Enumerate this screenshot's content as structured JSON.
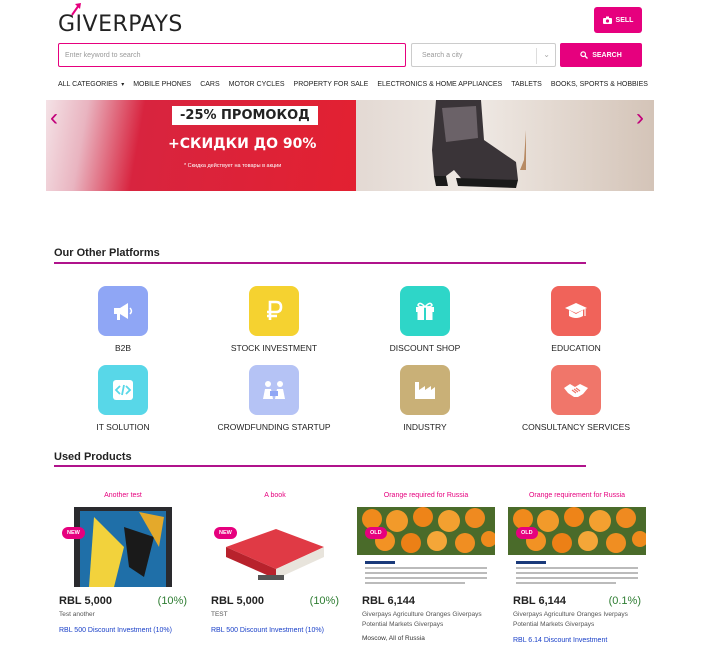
{
  "header": {
    "logo": "GIVERPAYS",
    "sell_label": "SELL",
    "search_placeholder": "Enter keyword to search",
    "city_placeholder": "Search a city",
    "search_button": "SEARCH"
  },
  "categories": [
    "ALL CATEGORIES",
    "MOBILE PHONES",
    "CARS",
    "MOTOR CYCLES",
    "PROPERTY FOR SALE",
    "ELECTRONICS & HOME APPLIANCES",
    "TABLETS",
    "BOOKS, SPORTS & HOBBIES"
  ],
  "banner": {
    "line1": "-25% ПРОМОКОД",
    "line2": "+СКИДКИ ДО 90%",
    "line3": "* Скидка действует на товары в акции"
  },
  "platforms_section": {
    "title": "Our Other Platforms",
    "items": [
      {
        "label": "B2B",
        "icon": "megaphone-icon",
        "color": "#8fa6f5"
      },
      {
        "label": "STOCK INVESTMENT",
        "icon": "ruble-icon",
        "color": "#f5d230"
      },
      {
        "label": "DISCOUNT SHOP",
        "icon": "gift-icon",
        "color": "#2ed6c8"
      },
      {
        "label": "EDUCATION",
        "icon": "graduation-cap-icon",
        "color": "#f0635a"
      },
      {
        "label": "IT SOLUTION",
        "icon": "code-icon",
        "color": "#58d7e8"
      },
      {
        "label": "CROWDFUNDING STARTUP",
        "icon": "people-icon",
        "color": "#b5c3f5"
      },
      {
        "label": "INDUSTRY",
        "icon": "factory-icon",
        "color": "#c9b077"
      },
      {
        "label": "CONSULTANCY SERVICES",
        "icon": "handshake-icon",
        "color": "#f0766a"
      }
    ]
  },
  "products_section": {
    "title": "Used Products",
    "items": [
      {
        "title": "Another test",
        "badge": "NEW",
        "price": "RBL 5,000",
        "discount": "(10%)",
        "desc": "Test another",
        "link": "RBL 500 Discount Investment (10%)"
      },
      {
        "title": "A book",
        "badge": "NEW",
        "price": "RBL 5,000",
        "discount": "(10%)",
        "desc": "TEST",
        "link": "RBL 500 Discount Investment (10%)"
      },
      {
        "title": "Orange required for Russia",
        "badge": "OLD",
        "price": "RBL 6,144",
        "discount": "",
        "desc": "Giverpays Agriculture Oranges Giverpays Potential Markets Giverpays",
        "link": "Moscow, All of Russia"
      },
      {
        "title": "Orange requirement for Russia",
        "badge": "OLD",
        "price": "RBL 6,144",
        "discount": "(0.1%)",
        "desc": "Giverpays Agriculture Oranges Iverpays Potential Markets Giverpays",
        "link": "RBL 6.14 Discount Investment"
      }
    ]
  },
  "colors": {
    "brand": "#e6007e",
    "section_line": "#b0138c",
    "discount_green": "#2e7d32",
    "link_blue": "#1a40c8"
  }
}
